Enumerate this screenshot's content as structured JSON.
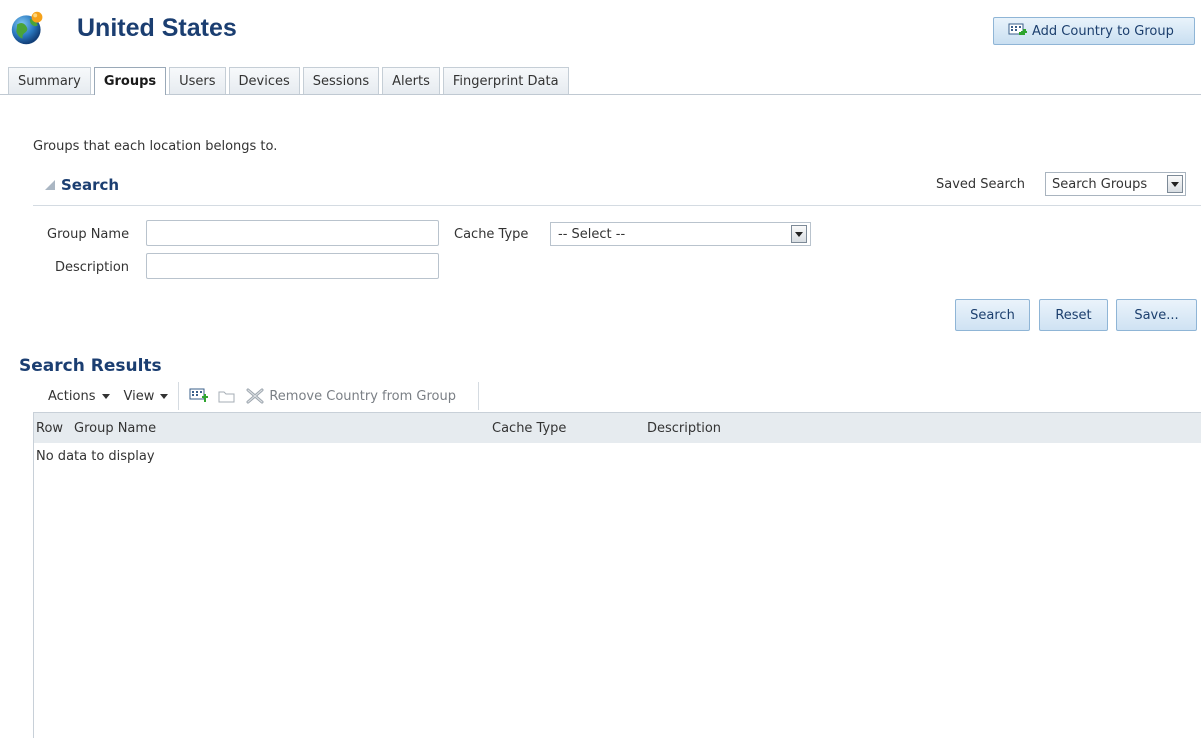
{
  "header": {
    "title": "United States",
    "globe_icon": "globe-icon",
    "add_button_label": "Add Country to Group"
  },
  "tabs": [
    {
      "label": "Summary",
      "active": false
    },
    {
      "label": "Groups",
      "active": true
    },
    {
      "label": "Users",
      "active": false
    },
    {
      "label": "Devices",
      "active": false
    },
    {
      "label": "Sessions",
      "active": false
    },
    {
      "label": "Alerts",
      "active": false
    },
    {
      "label": "Fingerprint Data",
      "active": false
    }
  ],
  "description": "Groups that each location belongs to.",
  "search": {
    "title": "Search",
    "saved_search_label": "Saved Search",
    "saved_search_value": "Search Groups",
    "fields": {
      "group_name_label": "Group Name",
      "group_name_value": "",
      "description_label": "Description",
      "description_value": "",
      "cache_type_label": "Cache Type",
      "cache_type_value": "-- Select --"
    },
    "buttons": {
      "search": "Search",
      "reset": "Reset",
      "save": "Save..."
    }
  },
  "results": {
    "title": "Search Results",
    "toolbar": {
      "actions_label": "Actions",
      "view_label": "View",
      "remove_label": "Remove Country from Group"
    },
    "columns": [
      "Row",
      "Group Name",
      "Cache Type",
      "Description"
    ],
    "empty_text": "No data to display"
  },
  "colors": {
    "title": "#1b3e71",
    "button_border": "#8fb5d6",
    "header_bg": "#e6ebef"
  }
}
